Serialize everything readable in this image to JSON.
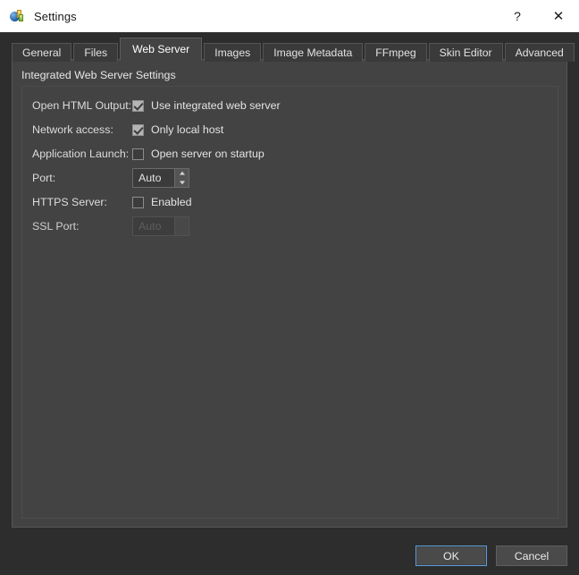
{
  "window": {
    "title": "Settings",
    "app_icon": "app-chart-icon",
    "controls": [
      {
        "name": "help",
        "glyph": "?"
      },
      {
        "name": "close",
        "glyph": "✕"
      }
    ]
  },
  "tabs": [
    {
      "label": "General",
      "selected": false
    },
    {
      "label": "Files",
      "selected": false
    },
    {
      "label": "Web Server",
      "selected": true
    },
    {
      "label": "Images",
      "selected": false
    },
    {
      "label": "Image Metadata",
      "selected": false
    },
    {
      "label": "FFmpeg",
      "selected": false
    },
    {
      "label": "Skin Editor",
      "selected": false
    },
    {
      "label": "Advanced",
      "selected": false
    }
  ],
  "group": {
    "title": "Integrated Web Server Settings"
  },
  "fields": {
    "open_html_output": {
      "label": "Open HTML Output:",
      "checkbox_label": "Use integrated web server",
      "checked": true
    },
    "network_access": {
      "label": "Network access:",
      "checkbox_label": "Only local host",
      "checked": true
    },
    "application_launch": {
      "label": "Application Launch:",
      "checkbox_label": "Open server on startup",
      "checked": false
    },
    "port": {
      "label": "Port:",
      "value": "Auto",
      "enabled": true
    },
    "https_server": {
      "label": "HTTPS Server:",
      "checkbox_label": "Enabled",
      "checked": false
    },
    "ssl_port": {
      "label": "SSL Port:",
      "value": "Auto",
      "enabled": false
    }
  },
  "footer": {
    "ok_label": "OK",
    "cancel_label": "Cancel"
  },
  "colors": {
    "titlebar_bg": "#ffffff",
    "dialog_bg": "#2d2d2d",
    "panel_bg": "#434343",
    "text": "#dcdcdc",
    "accent_focus": "#5b9ddb"
  }
}
